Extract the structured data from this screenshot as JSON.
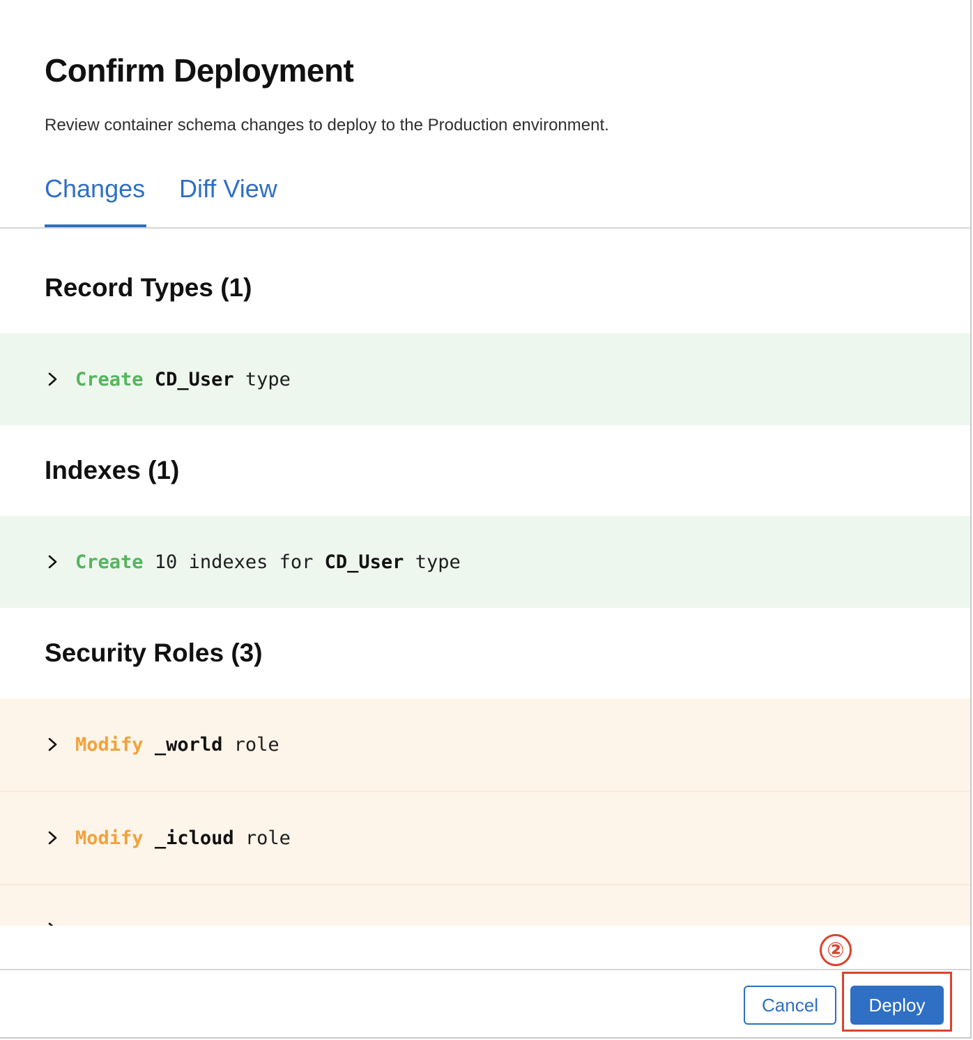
{
  "dialog": {
    "title": "Confirm Deployment",
    "subtitle": "Review container schema changes to deploy to the Production environment."
  },
  "tabs": [
    {
      "label": "Changes",
      "active": true
    },
    {
      "label": "Diff View",
      "active": false
    }
  ],
  "sections": {
    "record_types": {
      "heading": "Record Types (1)",
      "rows": [
        {
          "verb": "Create",
          "subject": "CD_User",
          "suffix": " type"
        }
      ]
    },
    "indexes": {
      "heading": "Indexes (1)",
      "rows": [
        {
          "verb": "Create",
          "middle": " 10 indexes for ",
          "subject": "CD_User",
          "suffix": " type"
        }
      ]
    },
    "security_roles": {
      "heading": "Security Roles (3)",
      "rows": [
        {
          "verb": "Modify",
          "subject": "_world",
          "suffix": " role"
        },
        {
          "verb": "Modify",
          "subject": "_icloud",
          "suffix": " role"
        }
      ]
    }
  },
  "footer": {
    "cancel_label": "Cancel",
    "deploy_label": "Deploy"
  },
  "annotation": {
    "step_number": "②",
    "color": "#d9432f"
  },
  "colors": {
    "accent": "#2f6fc4",
    "create": "#55b55e",
    "modify": "#f0a23e"
  }
}
